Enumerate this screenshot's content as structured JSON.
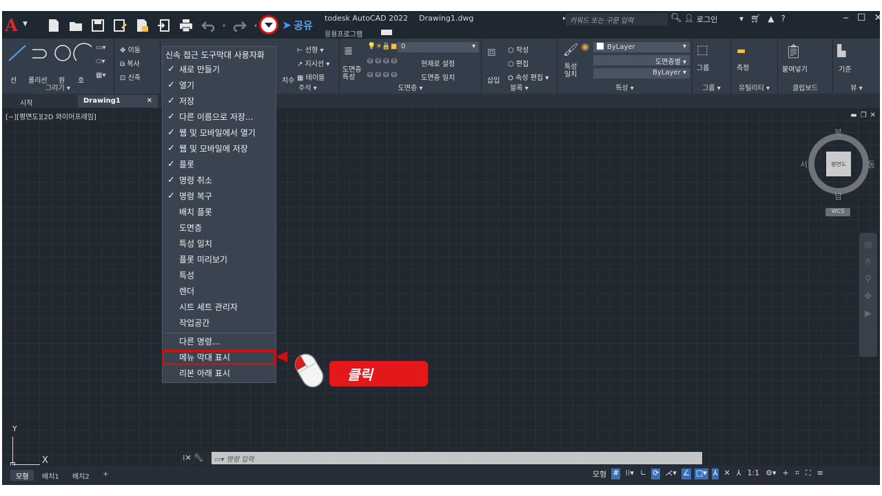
{
  "title": {
    "app_name": "todesk AutoCAD 2022",
    "file_name": "Drawing1.dwg",
    "share_label": "공유",
    "sub_tab": "응용프로그램",
    "search_placeholder": "키워드 또는 구문 입력",
    "login_label": "로그인"
  },
  "ribbon": {
    "groups": [
      {
        "label": "그리기 ▾"
      },
      {
        "label": "주석 ▾"
      },
      {
        "label": "도면층 ▾"
      },
      {
        "label": "블록 ▾"
      },
      {
        "label": "특성 ▾"
      },
      {
        "label": "그룹 ▾"
      },
      {
        "label": "유틸리티 ▾"
      },
      {
        "label": "클립보드"
      },
      {
        "label": "뷰 ▾"
      }
    ],
    "draw_tools": {
      "line": "선",
      "polyline": "폴리선",
      "circle": "원",
      "arc": "호"
    },
    "modify_tools": {
      "move": "이동",
      "copy": "복사",
      "stretch": "신축"
    },
    "annotation_tools": {
      "linear": "선형",
      "leader": "지시선",
      "table": "테이블",
      "dimension": "치수"
    },
    "layer_tools": {
      "layer_props": "도면층\n특성",
      "layer_value": "0",
      "set_current": "현재로 설정",
      "match_layer": "도면층 일치"
    },
    "block_tools": {
      "insert": "삽입",
      "create": "작성",
      "edit": "편집",
      "attr_edit": "속성 편집"
    },
    "props_tools": {
      "match": "특성\n일치",
      "color": "ByLayer",
      "linetype": "도면층별",
      "lineweight": "ByLayer"
    },
    "group_tools": {
      "group": "그룹"
    },
    "util_tools": {
      "measure": "측정"
    },
    "clip_tools": {
      "paste": "붙여넣기"
    },
    "view_tools": {
      "base": "기준"
    }
  },
  "doc_tabs": [
    {
      "label": "시작"
    },
    {
      "label": "Drawing1"
    }
  ],
  "viewport": {
    "label": "[−][평면도][2D 와이어프레임]",
    "viewcube_face": "평면도",
    "north": "북",
    "south": "남",
    "east": "동",
    "west": "서",
    "wcs": "WCS"
  },
  "ucs": {
    "x": "X",
    "y": "Y"
  },
  "command_line": {
    "placeholder": "명령 입력"
  },
  "layout_tabs": [
    {
      "label": "모형"
    },
    {
      "label": "배치1"
    },
    {
      "label": "배치2"
    },
    {
      "label": "+"
    }
  ],
  "status": {
    "model": "모형",
    "scale": "1:1"
  },
  "menu": {
    "title": "신속 접근 도구막대 사용자화",
    "items": [
      {
        "label": "새로 만들기",
        "checked": "✓"
      },
      {
        "label": "열기",
        "checked": "✓"
      },
      {
        "label": "저장",
        "checked": "✓"
      },
      {
        "label": "다른 이름으로 저장...",
        "checked": "✓"
      },
      {
        "label": "웹 및 모바일에서 열기",
        "checked": "✓"
      },
      {
        "label": "웹 및 모바일에 저장",
        "checked": "✓"
      },
      {
        "label": "플롯",
        "checked": "✓"
      },
      {
        "label": "명령 취소",
        "checked": "✓"
      },
      {
        "label": "명령 복구",
        "checked": "✓"
      },
      {
        "label": "배치 플롯",
        "checked": ""
      },
      {
        "label": "도면층",
        "checked": ""
      },
      {
        "label": "특성 일치",
        "checked": ""
      },
      {
        "label": "플롯 미리보기",
        "checked": ""
      },
      {
        "label": "특성",
        "checked": ""
      },
      {
        "label": "렌더",
        "checked": ""
      },
      {
        "label": "시트 세트 관리자",
        "checked": ""
      },
      {
        "label": "작업공간",
        "checked": ""
      }
    ],
    "more": "다른 명령...",
    "show_menubar": "메뉴 막대 표시",
    "show_below_ribbon": "리본 아래 표시"
  },
  "annotation": {
    "click_label": "클릭",
    "highlight_color": "#d10f0f"
  }
}
